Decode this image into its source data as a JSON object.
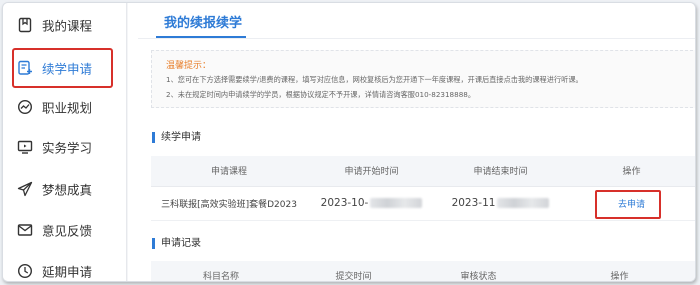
{
  "sidebar": {
    "items": [
      {
        "label": "我的课程",
        "icon": "bookmark-icon"
      },
      {
        "label": "续学申请",
        "icon": "continue-study-icon",
        "active": true
      },
      {
        "label": "职业规划",
        "icon": "career-plan-icon"
      },
      {
        "label": "实务学习",
        "icon": "practice-monitor-icon"
      },
      {
        "label": "梦想成真",
        "icon": "paper-plane-icon"
      },
      {
        "label": "意见反馈",
        "icon": "mail-icon"
      },
      {
        "label": "延期申请",
        "icon": "clock-icon"
      }
    ]
  },
  "page": {
    "title": "我的续报续学"
  },
  "notice": {
    "title": "温馨提示：",
    "lines": [
      "1、您可在下方选择需要续学/退费的课程，填写对应信息，网校复核后为您开通下一年度课程，开课后直接点击我的课程进行听课。",
      "2、未在规定时间内申请续学的学员，根据协议规定不予开课，详情请咨询客服010-82318888。"
    ]
  },
  "apply_section": {
    "title": "续学申请",
    "columns": [
      "申请课程",
      "申请开始时间",
      "申请结束时间",
      "操作"
    ],
    "rows": [
      {
        "course": "三科联报[高效实验班]套餐D2023",
        "start": "2023-10-",
        "end": "2023-11",
        "action": "去申请"
      }
    ]
  },
  "record_section": {
    "title": "申请记录",
    "columns": [
      "科目名称",
      "提交时间",
      "审核状态",
      "操作"
    ]
  },
  "colors": {
    "accent": "#2e7bd6",
    "highlight": "#d7302a",
    "notice_title": "#e8802d"
  }
}
